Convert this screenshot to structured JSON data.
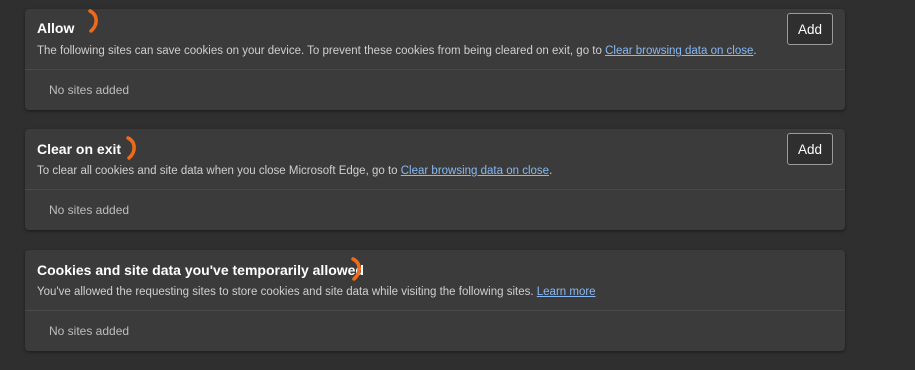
{
  "allow": {
    "title": "Allow",
    "description": "The following sites can save cookies on your device. To prevent these cookies from being cleared on exit, go to",
    "link": "Clear browsing data on close",
    "trailing": ".",
    "add_label": "Add",
    "empty_text": "No sites added"
  },
  "clear_on_exit": {
    "title": "Clear on exit",
    "description": "To clear all cookies and site data when you close Microsoft Edge, go to",
    "link": "Clear browsing data on close",
    "trailing": ".",
    "add_label": "Add",
    "empty_text": "No sites added"
  },
  "temporarily_allowed": {
    "title": "Cookies and site data you've temporarily allowed",
    "description": "You've allowed the requesting sites to store cookies and site data while visiting the following sites.",
    "link": "Learn more",
    "empty_text": "No sites added"
  },
  "colors": {
    "annotation_marks": "#f06a1c",
    "link": "#86b9f4"
  }
}
